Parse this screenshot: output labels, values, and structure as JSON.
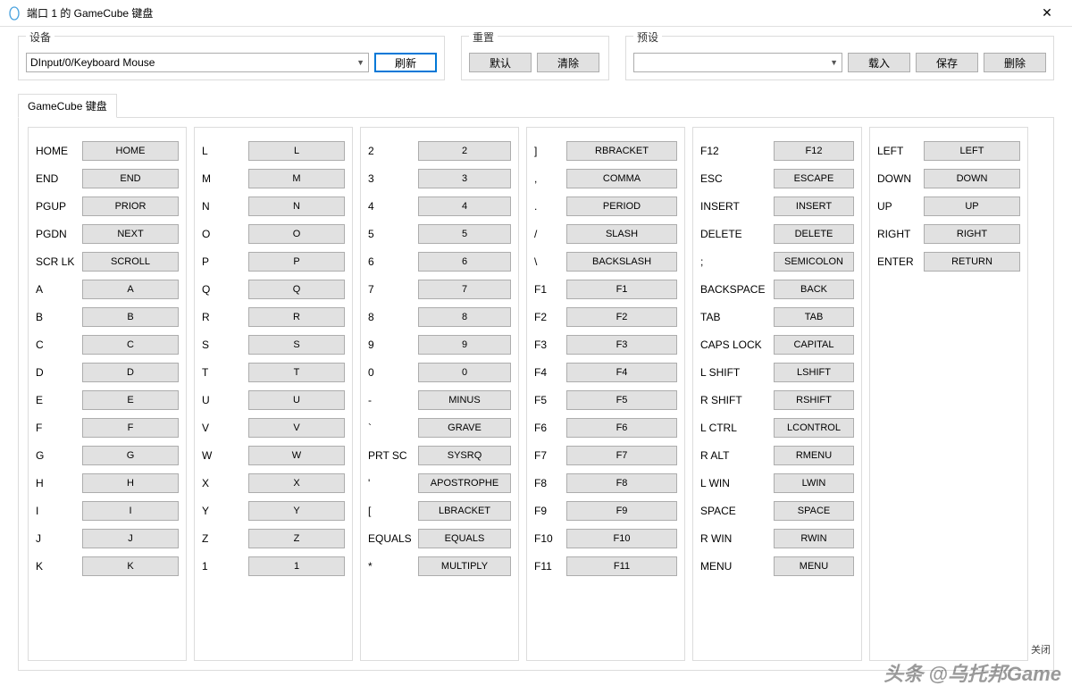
{
  "window": {
    "title": "端口 1 的 GameCube 键盘",
    "close": "✕"
  },
  "device": {
    "legend": "设备",
    "selected": "DInput/0/Keyboard Mouse",
    "refresh": "刷新"
  },
  "reset": {
    "legend": "重置",
    "default": "默认",
    "clear": "清除"
  },
  "preset": {
    "legend": "预设",
    "selected": "",
    "load": "载入",
    "save": "保存",
    "delete": "删除"
  },
  "tab": {
    "label": "GameCube 键盘"
  },
  "cols": [
    [
      {
        "l": "HOME",
        "v": "HOME"
      },
      {
        "l": "END",
        "v": "END"
      },
      {
        "l": "PGUP",
        "v": "PRIOR"
      },
      {
        "l": "PGDN",
        "v": "NEXT"
      },
      {
        "l": "SCR LK",
        "v": "SCROLL"
      },
      {
        "l": "A",
        "v": "A"
      },
      {
        "l": "B",
        "v": "B"
      },
      {
        "l": "C",
        "v": "C"
      },
      {
        "l": "D",
        "v": "D"
      },
      {
        "l": "E",
        "v": "E"
      },
      {
        "l": "F",
        "v": "F"
      },
      {
        "l": "G",
        "v": "G"
      },
      {
        "l": "H",
        "v": "H"
      },
      {
        "l": "I",
        "v": "I"
      },
      {
        "l": "J",
        "v": "J"
      },
      {
        "l": "K",
        "v": "K"
      }
    ],
    [
      {
        "l": "L",
        "v": "L"
      },
      {
        "l": "M",
        "v": "M"
      },
      {
        "l": "N",
        "v": "N"
      },
      {
        "l": "O",
        "v": "O"
      },
      {
        "l": "P",
        "v": "P"
      },
      {
        "l": "Q",
        "v": "Q"
      },
      {
        "l": "R",
        "v": "R"
      },
      {
        "l": "S",
        "v": "S"
      },
      {
        "l": "T",
        "v": "T"
      },
      {
        "l": "U",
        "v": "U"
      },
      {
        "l": "V",
        "v": "V"
      },
      {
        "l": "W",
        "v": "W"
      },
      {
        "l": "X",
        "v": "X"
      },
      {
        "l": "Y",
        "v": "Y"
      },
      {
        "l": "Z",
        "v": "Z"
      },
      {
        "l": "1",
        "v": "1"
      }
    ],
    [
      {
        "l": "2",
        "v": "2"
      },
      {
        "l": "3",
        "v": "3"
      },
      {
        "l": "4",
        "v": "4"
      },
      {
        "l": "5",
        "v": "5"
      },
      {
        "l": "6",
        "v": "6"
      },
      {
        "l": "7",
        "v": "7"
      },
      {
        "l": "8",
        "v": "8"
      },
      {
        "l": "9",
        "v": "9"
      },
      {
        "l": "0",
        "v": "0"
      },
      {
        "l": "-",
        "v": "MINUS"
      },
      {
        "l": "`",
        "v": "GRAVE"
      },
      {
        "l": "PRT SC",
        "v": "SYSRQ"
      },
      {
        "l": "'",
        "v": "APOSTROPHE"
      },
      {
        "l": "[",
        "v": "LBRACKET"
      },
      {
        "l": "EQUALS",
        "v": "EQUALS"
      },
      {
        "l": "*",
        "v": "MULTIPLY"
      }
    ],
    [
      {
        "l": "]",
        "v": "RBRACKET"
      },
      {
        "l": ",",
        "v": "COMMA"
      },
      {
        "l": ".",
        "v": "PERIOD"
      },
      {
        "l": "/",
        "v": "SLASH"
      },
      {
        "l": "\\",
        "v": "BACKSLASH"
      },
      {
        "l": "F1",
        "v": "F1"
      },
      {
        "l": "F2",
        "v": "F2"
      },
      {
        "l": "F3",
        "v": "F3"
      },
      {
        "l": "F4",
        "v": "F4"
      },
      {
        "l": "F5",
        "v": "F5"
      },
      {
        "l": "F6",
        "v": "F6"
      },
      {
        "l": "F7",
        "v": "F7"
      },
      {
        "l": "F8",
        "v": "F8"
      },
      {
        "l": "F9",
        "v": "F9"
      },
      {
        "l": "F10",
        "v": "F10"
      },
      {
        "l": "F11",
        "v": "F11"
      }
    ],
    [
      {
        "l": "F12",
        "v": "F12"
      },
      {
        "l": "ESC",
        "v": "ESCAPE"
      },
      {
        "l": "INSERT",
        "v": "INSERT"
      },
      {
        "l": "DELETE",
        "v": "DELETE"
      },
      {
        "l": ";",
        "v": "SEMICOLON"
      },
      {
        "l": "BACKSPACE",
        "v": "BACK"
      },
      {
        "l": "TAB",
        "v": "TAB"
      },
      {
        "l": "CAPS LOCK",
        "v": "CAPITAL"
      },
      {
        "l": "L SHIFT",
        "v": "LSHIFT"
      },
      {
        "l": "R SHIFT",
        "v": "RSHIFT"
      },
      {
        "l": "L CTRL",
        "v": "LCONTROL"
      },
      {
        "l": "R ALT",
        "v": "RMENU"
      },
      {
        "l": "L WIN",
        "v": "LWIN"
      },
      {
        "l": "SPACE",
        "v": "SPACE"
      },
      {
        "l": "R WIN",
        "v": "RWIN"
      },
      {
        "l": "MENU",
        "v": "MENU"
      }
    ],
    [
      {
        "l": "LEFT",
        "v": "LEFT"
      },
      {
        "l": "DOWN",
        "v": "DOWN"
      },
      {
        "l": "UP",
        "v": "UP"
      },
      {
        "l": "RIGHT",
        "v": "RIGHT"
      },
      {
        "l": "ENTER",
        "v": "RETURN"
      }
    ]
  ],
  "footer": {
    "close": "关闭"
  },
  "watermark": "头条 @乌托邦Game"
}
